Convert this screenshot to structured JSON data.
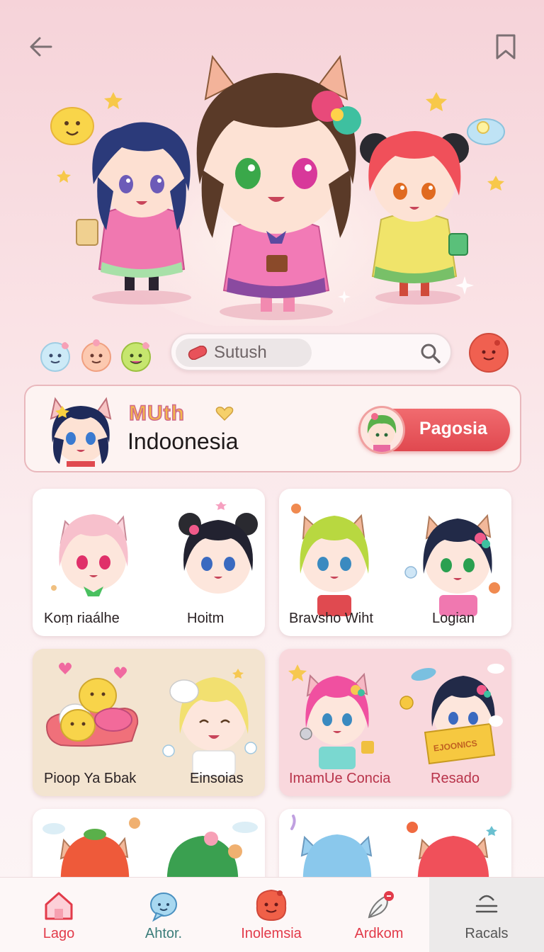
{
  "search": {
    "text": "Sutush"
  },
  "promo": {
    "tag": "MUth",
    "title": "Indoonesia",
    "button_label": "Pagosia"
  },
  "cards": [
    {
      "left_label": "Koṃ riaálhe",
      "right_label": "Hoitm"
    },
    {
      "left_label": "Bravsho Wiht",
      "right_label": "Logian"
    },
    {
      "left_label": "Pioop Ya Бbak",
      "right_label": "Einsoias"
    },
    {
      "left_label": "ImamUe Concia",
      "right_label": "Resado"
    }
  ],
  "card_sign_text": "EJOONICS",
  "nav": [
    {
      "label": "Lago",
      "icon": "home-icon",
      "color": "#e23b4a"
    },
    {
      "label": "Ahtor.",
      "icon": "chat-bubble-icon",
      "color": "#3b7d7a"
    },
    {
      "label": "Inolemsia",
      "icon": "blob-face-icon",
      "color": "#e23b4a"
    },
    {
      "label": "Ardkom",
      "icon": "feather-icon",
      "color": "#e23b4a"
    },
    {
      "label": "Racals",
      "icon": "menu-lines-icon",
      "color": "#555"
    }
  ],
  "colors": {
    "accent": "#e23b4a",
    "background": "#f6d3d9",
    "promo_border": "#e9b8bd"
  }
}
